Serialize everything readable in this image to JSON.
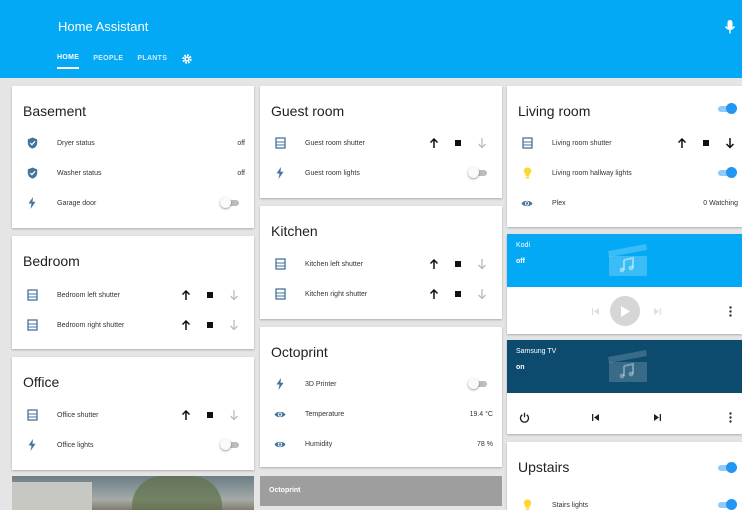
{
  "app": {
    "title": "Home Assistant"
  },
  "tabs": [
    "HOME",
    "PEOPLE",
    "PLANTS"
  ],
  "colors": {
    "primary": "#03a9f4",
    "accent": "#2196f3",
    "kodi": "#03a9f4",
    "samsung": "#0d4b6e"
  },
  "cards": {
    "basement": {
      "title": "Basement",
      "rows": [
        {
          "label": "Dryer status",
          "value": "off",
          "icon": "shield-icon"
        },
        {
          "label": "Washer status",
          "value": "off",
          "icon": "shield-icon"
        },
        {
          "label": "Garage door",
          "icon": "flash-icon",
          "toggle": "off"
        }
      ]
    },
    "bedroom": {
      "title": "Bedroom",
      "rows": [
        {
          "label": "Bedroom left shutter",
          "icon": "window-shutter-icon"
        },
        {
          "label": "Bedroom right shutter",
          "icon": "window-shutter-icon"
        }
      ]
    },
    "office": {
      "title": "Office",
      "rows": [
        {
          "label": "Office shutter",
          "icon": "window-shutter-icon"
        },
        {
          "label": "Office lights",
          "icon": "flash-icon",
          "toggle": "off"
        }
      ]
    },
    "guest_room": {
      "title": "Guest room",
      "rows": [
        {
          "label": "Guest room shutter",
          "icon": "window-shutter-icon"
        },
        {
          "label": "Guest room lights",
          "icon": "flash-icon",
          "toggle": "off"
        }
      ]
    },
    "kitchen": {
      "title": "Kitchen",
      "rows": [
        {
          "label": "Kitchen left shutter",
          "icon": "window-shutter-icon"
        },
        {
          "label": "Kitchen right shutter",
          "icon": "window-shutter-icon"
        }
      ]
    },
    "octoprint": {
      "title": "Octoprint",
      "rows": [
        {
          "label": "3D Printer",
          "icon": "flash-icon",
          "toggle": "off"
        },
        {
          "label": "Temperature",
          "value": "19.4 °C",
          "icon": "eye-icon"
        },
        {
          "label": "Humidity",
          "value": "78 %",
          "icon": "eye-icon"
        }
      ],
      "footer": "Octoprint"
    },
    "living_room": {
      "title": "Living room",
      "header_toggle": "on",
      "rows": [
        {
          "label": "Living room shutter",
          "icon": "window-shutter-icon"
        },
        {
          "label": "Living room hallway lights",
          "icon": "lightbulb-icon",
          "toggle": "on"
        },
        {
          "label": "Plex",
          "value": "0 Watching",
          "icon": "eye-icon"
        }
      ]
    },
    "kodi": {
      "name": "Kodi",
      "state": "off"
    },
    "samsung": {
      "name": "Samsung TV",
      "state": "on"
    },
    "upstairs": {
      "title": "Upstairs",
      "header_toggle": "on",
      "rows": [
        {
          "label": "Stairs lights",
          "icon": "lightbulb-icon",
          "toggle": "on"
        }
      ]
    }
  }
}
